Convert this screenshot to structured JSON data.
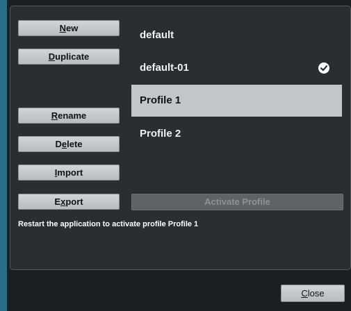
{
  "buttons": {
    "new": {
      "first": "N",
      "rest": "ew"
    },
    "duplicate": {
      "first": "D",
      "rest": "uplicate"
    },
    "rename": {
      "first": "R",
      "rest": "ename"
    },
    "delete": {
      "before": "D",
      "ul": "e",
      "after": "lete"
    },
    "import": {
      "first": "I",
      "rest": "mport"
    },
    "export": {
      "before": "E",
      "ul": "x",
      "after": "port"
    }
  },
  "profiles": [
    {
      "name": "default",
      "active": false,
      "selected": false
    },
    {
      "name": "default-01",
      "active": true,
      "selected": false
    },
    {
      "name": "Profile 1",
      "active": false,
      "selected": true
    },
    {
      "name": "Profile 2",
      "active": false,
      "selected": false
    }
  ],
  "activate_button": {
    "label": "Activate Profile",
    "enabled": false
  },
  "status_message": "Restart the application to activate profile Profile 1",
  "close_button": {
    "first": "C",
    "rest": "lose"
  },
  "icons": {
    "active_marker": "checkmark-circle-icon"
  },
  "colors": {
    "panel_bg": "#2b2e31",
    "dialog_bg": "#1c1f22",
    "selected_bg": "#c3c6c8",
    "button_bg": "#c7cacc",
    "accent_edge": "#2a6d86"
  }
}
